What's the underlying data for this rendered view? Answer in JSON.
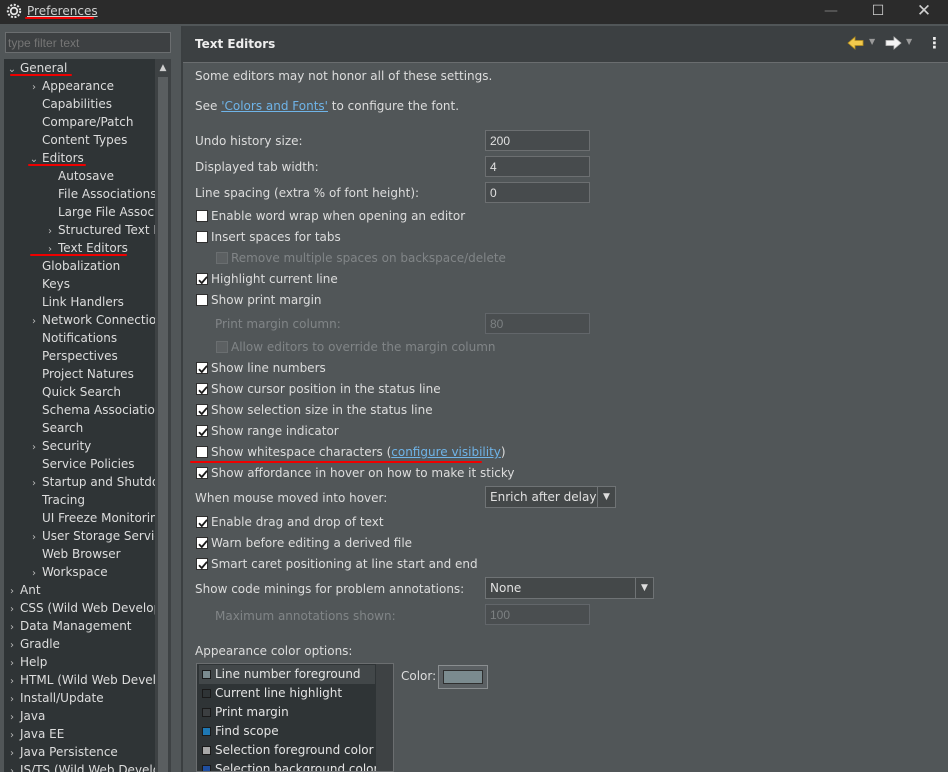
{
  "window": {
    "title": "Preferences",
    "minimize": "—",
    "maximize": "☐",
    "close": "✕"
  },
  "filter": {
    "placeholder": "type filter text"
  },
  "tree": [
    {
      "label": "General",
      "twisty": "⌄",
      "level": 0
    },
    {
      "label": "Appearance",
      "twisty": "›",
      "level": 1
    },
    {
      "label": "Capabilities",
      "twisty": "",
      "level": 1
    },
    {
      "label": "Compare/Patch",
      "twisty": "",
      "level": 1
    },
    {
      "label": "Content Types",
      "twisty": "",
      "level": 1
    },
    {
      "label": "Editors",
      "twisty": "⌄",
      "level": 1
    },
    {
      "label": "Autosave",
      "twisty": "",
      "level": 2
    },
    {
      "label": "File Associations",
      "twisty": "",
      "level": 2
    },
    {
      "label": "Large File Associations",
      "twisty": "",
      "level": 2
    },
    {
      "label": "Structured Text Editors",
      "twisty": "›",
      "level": 2
    },
    {
      "label": "Text Editors",
      "twisty": "›",
      "level": 2
    },
    {
      "label": "Globalization",
      "twisty": "",
      "level": 1
    },
    {
      "label": "Keys",
      "twisty": "",
      "level": 1
    },
    {
      "label": "Link Handlers",
      "twisty": "",
      "level": 1
    },
    {
      "label": "Network Connections",
      "twisty": "›",
      "level": 1
    },
    {
      "label": "Notifications",
      "twisty": "",
      "level": 1
    },
    {
      "label": "Perspectives",
      "twisty": "",
      "level": 1
    },
    {
      "label": "Project Natures",
      "twisty": "",
      "level": 1
    },
    {
      "label": "Quick Search",
      "twisty": "",
      "level": 1
    },
    {
      "label": "Schema Associations",
      "twisty": "",
      "level": 1
    },
    {
      "label": "Search",
      "twisty": "",
      "level": 1
    },
    {
      "label": "Security",
      "twisty": "›",
      "level": 1
    },
    {
      "label": "Service Policies",
      "twisty": "",
      "level": 1
    },
    {
      "label": "Startup and Shutdown",
      "twisty": "›",
      "level": 1
    },
    {
      "label": "Tracing",
      "twisty": "",
      "level": 1
    },
    {
      "label": "UI Freeze Monitoring",
      "twisty": "",
      "level": 1
    },
    {
      "label": "User Storage Service",
      "twisty": "›",
      "level": 1
    },
    {
      "label": "Web Browser",
      "twisty": "",
      "level": 1
    },
    {
      "label": "Workspace",
      "twisty": "›",
      "level": 1
    },
    {
      "label": "Ant",
      "twisty": "›",
      "level": 0
    },
    {
      "label": "CSS (Wild Web Developer)",
      "twisty": "›",
      "level": 0
    },
    {
      "label": "Data Management",
      "twisty": "›",
      "level": 0
    },
    {
      "label": "Gradle",
      "twisty": "›",
      "level": 0
    },
    {
      "label": "Help",
      "twisty": "›",
      "level": 0
    },
    {
      "label": "HTML (Wild Web Developer)",
      "twisty": "›",
      "level": 0
    },
    {
      "label": "Install/Update",
      "twisty": "›",
      "level": 0
    },
    {
      "label": "Java",
      "twisty": "›",
      "level": 0
    },
    {
      "label": "Java EE",
      "twisty": "›",
      "level": 0
    },
    {
      "label": "Java Persistence",
      "twisty": "›",
      "level": 0
    },
    {
      "label": "JS/TS (Wild Web Developer)",
      "twisty": "›",
      "level": 0
    }
  ],
  "page": {
    "title": "Text Editors",
    "note": "Some editors may not honor all of these settings.",
    "see_prefix": "See ",
    "colors_link": "'Colors and Fonts'",
    "see_suffix": " to configure the font.",
    "undo_label": "Undo history size:",
    "undo_value": "200",
    "tab_label": "Displayed tab width:",
    "tab_value": "4",
    "spacing_label": "Line spacing (extra % of font height):",
    "spacing_value": "0",
    "word_wrap": {
      "label": "Enable word wrap when opening an editor",
      "checked": false
    },
    "insert_spaces": {
      "label": "Insert spaces for tabs",
      "checked": false
    },
    "remove_spaces": {
      "label": "Remove multiple spaces on backspace/delete",
      "checked": false
    },
    "highlight_line": {
      "label": "Highlight current line",
      "checked": true
    },
    "print_margin": {
      "label": "Show print margin",
      "checked": false
    },
    "margin_col_label": "Print margin column:",
    "margin_col_value": "80",
    "allow_override": {
      "label": "Allow editors to override the margin column",
      "checked": false
    },
    "line_numbers": {
      "label": "Show line numbers",
      "checked": true
    },
    "cursor_pos": {
      "label": "Show cursor position in the status line",
      "checked": true
    },
    "sel_size": {
      "label": "Show selection size in the status line",
      "checked": true
    },
    "range_ind": {
      "label": "Show range indicator",
      "checked": true
    },
    "whitespace": {
      "label": "Show whitespace characters (",
      "link": "configure visibility",
      "close": ")",
      "checked": false
    },
    "affordance": {
      "label": "Show affordance in hover on how to make it sticky",
      "checked": true
    },
    "hover_label": "When mouse moved into hover:",
    "hover_value": "Enrich after delay",
    "drag_drop": {
      "label": "Enable drag and drop of text",
      "checked": true
    },
    "warn_derived": {
      "label": "Warn before editing a derived file",
      "checked": true
    },
    "smart_caret": {
      "label": "Smart caret positioning at line start and end",
      "checked": true
    },
    "minings_label": "Show code minings for problem annotations:",
    "minings_value": "None",
    "max_ann_label": "Maximum annotations shown:",
    "max_ann_value": "100",
    "appearance_label": "Appearance color options:",
    "color_label": "Color:",
    "color_options": [
      {
        "label": "Line number foreground",
        "swatch": "#7b8b8f"
      },
      {
        "label": "Current line highlight",
        "swatch": "#2f3436"
      },
      {
        "label": "Print margin",
        "swatch": "#3c3f41"
      },
      {
        "label": "Find scope",
        "swatch": "#1e78b4"
      },
      {
        "label": "Selection foreground color",
        "swatch": "#a8a8a8"
      },
      {
        "label": "Selection background color",
        "swatch": "#1f4fa0"
      }
    ],
    "selected_color": "#7b8b8f"
  },
  "annotation_color": "#ee0000"
}
